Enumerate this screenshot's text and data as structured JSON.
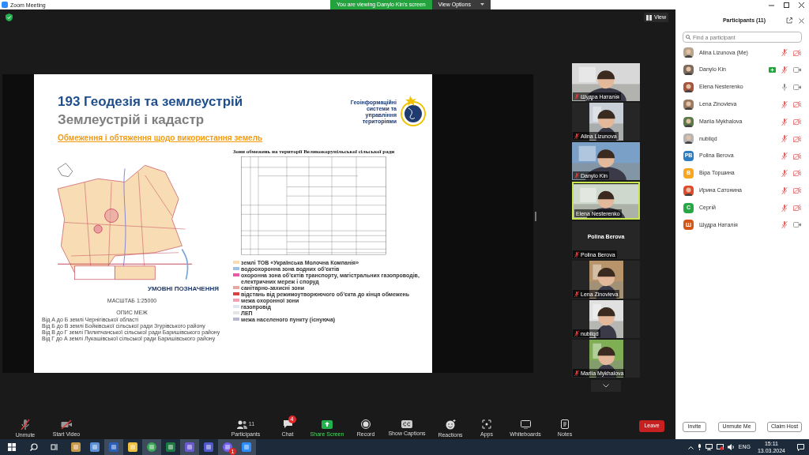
{
  "window": {
    "title": "Zoom Meeting"
  },
  "share_banner": {
    "text": "You are viewing Danylo Kin's screen",
    "options": "View Options"
  },
  "view_button": "View",
  "slide": {
    "title": "193 Геодезія та землеустрій",
    "subtitle": "Землеустрій і кадастр",
    "heading": "Обмеження і обтяження щодо використання земель",
    "logo_text": "Геоінформаційні системи та управління територіями",
    "table_title": "Зони обмежень на території Великокорупільської сільської ради",
    "legend_title": "УМОВНІ ПОЗНАЧЕННЯ",
    "scale": "МАСШТАБ 1:25000",
    "boundary_title": "ОПИС МЕЖ",
    "boundaries": [
      "Від А до Б землі Чернігівської області",
      "Від Б до В землі Бойківської сільської ради Згурівського району",
      "Від В до Г землі Пилипчанської сільської ради Баришівського району",
      "Від Г до А землі Лукашівської сільської ради Баришівського району"
    ],
    "legend": [
      {
        "label": "землі ТОВ «Українська Молочна Компанія»",
        "color": "#f7dcb4"
      },
      {
        "label": "водоохоронна зона водних об'єктів",
        "color": "#9cc3e6"
      },
      {
        "label": "охоронна зона об'єктів транспорту, магістральних газопроводів, електричних мереж і споруд",
        "color": "#e85aa8"
      },
      {
        "label": "санітарно-захисні зони",
        "color": "#e8a8a0"
      },
      {
        "label": "відстань від режимоутворюючого об'єкта до кінця обмежень",
        "color": "#d94040"
      },
      {
        "label": "межа охоронної зони",
        "color": "#f0a0b0"
      },
      {
        "label": "газопровід",
        "color": "#dde6ee"
      },
      {
        "label": "ЛЕП",
        "color": "#e4e4e4"
      },
      {
        "label": "межа населеного пункту (існуюча)",
        "color": "#b8b8d0"
      }
    ]
  },
  "video_tiles": [
    {
      "name": "Шудра Наталія",
      "kind": "video",
      "muted": true,
      "speaking": false
    },
    {
      "name": "Alina Lizunova",
      "kind": "video",
      "muted": true,
      "speaking": false
    },
    {
      "name": "Danylo Kin",
      "kind": "video",
      "muted": true,
      "speaking": false
    },
    {
      "name": "Elena Nesterenko",
      "kind": "video",
      "muted": false,
      "speaking": true
    },
    {
      "name": "Polina Berova",
      "kind": "name",
      "display": "Polina Berova",
      "muted": true,
      "speaking": false
    },
    {
      "name": "Lena Zinovieva",
      "kind": "video",
      "muted": true,
      "speaking": false
    },
    {
      "name": "nubilqd",
      "kind": "video",
      "muted": true,
      "speaking": false
    },
    {
      "name": "Mariia Mykhalova",
      "kind": "video",
      "muted": true,
      "speaking": false
    }
  ],
  "participants": {
    "title": "Participants (11)",
    "search_placeholder": "Find a participant",
    "items": [
      {
        "name": "Alina Lizunova (Me)",
        "sharing": false,
        "muted": true,
        "video_on": false
      },
      {
        "name": "Danylo Kin",
        "sharing": true,
        "muted": true,
        "video_on": true
      },
      {
        "name": "Elena Nesterenko",
        "sharing": false,
        "muted": false,
        "video_on": true
      },
      {
        "name": "Lena Zinovieva",
        "sharing": false,
        "muted": true,
        "video_on": false
      },
      {
        "name": "Mariia Mykhalova",
        "sharing": false,
        "muted": true,
        "video_on": false
      },
      {
        "name": "nubilqd",
        "sharing": false,
        "muted": true,
        "video_on": false
      },
      {
        "name": "Polina Berova",
        "avatar": {
          "kind": "initials",
          "text": "PB",
          "color": "#2e7bbf"
        },
        "sharing": false,
        "muted": true,
        "video_on": false
      },
      {
        "name": "Віра Торшина",
        "avatar": {
          "kind": "initials",
          "text": "В",
          "color": "#f5a623"
        },
        "sharing": false,
        "muted": true,
        "video_on": false
      },
      {
        "name": "Ирина Сатонина",
        "sharing": false,
        "muted": true,
        "video_on": false
      },
      {
        "name": "Сергій",
        "avatar": {
          "kind": "initials",
          "text": "С",
          "color": "#27a844"
        },
        "sharing": false,
        "muted": true,
        "video_on": false
      },
      {
        "name": "Шудра Наталія",
        "avatar": {
          "kind": "initials",
          "text": "Ш",
          "color": "#d4571a"
        },
        "sharing": false,
        "muted": true,
        "video_on": true
      }
    ],
    "buttons": [
      "Invite",
      "Unmute Me",
      "Claim Host"
    ]
  },
  "toolbar": {
    "items": [
      {
        "kind": "mic",
        "label": "Unmute",
        "off": true
      },
      {
        "kind": "video",
        "label": "Start Video",
        "off": true
      },
      {
        "kind": "participants",
        "label": "Participants",
        "count": "11"
      },
      {
        "kind": "chat",
        "label": "Chat",
        "badge": "4"
      },
      {
        "kind": "share",
        "label": "Share Screen"
      },
      {
        "kind": "record",
        "label": "Record"
      },
      {
        "kind": "captions",
        "label": "Show Captions"
      },
      {
        "kind": "reactions",
        "label": "Reactions"
      },
      {
        "kind": "apps",
        "label": "Apps"
      },
      {
        "kind": "whiteboards",
        "label": "Whiteboards"
      },
      {
        "kind": "notes",
        "label": "Notes"
      }
    ],
    "leave": "Leave"
  },
  "taskbar": {
    "apps": [
      {
        "kind": "paint",
        "active": false
      },
      {
        "kind": "calculator",
        "active": false
      },
      {
        "kind": "word",
        "active": true
      },
      {
        "kind": "files",
        "active": false
      },
      {
        "kind": "browser",
        "active": true
      },
      {
        "kind": "excel",
        "active": false
      },
      {
        "kind": "disk",
        "active": true
      },
      {
        "kind": "teams",
        "active": false
      },
      {
        "kind": "viber",
        "active": true,
        "badge": "1"
      },
      {
        "kind": "zoom",
        "active": true
      }
    ],
    "language": "ENG",
    "time": "15:11",
    "date": "13.03.2024"
  }
}
